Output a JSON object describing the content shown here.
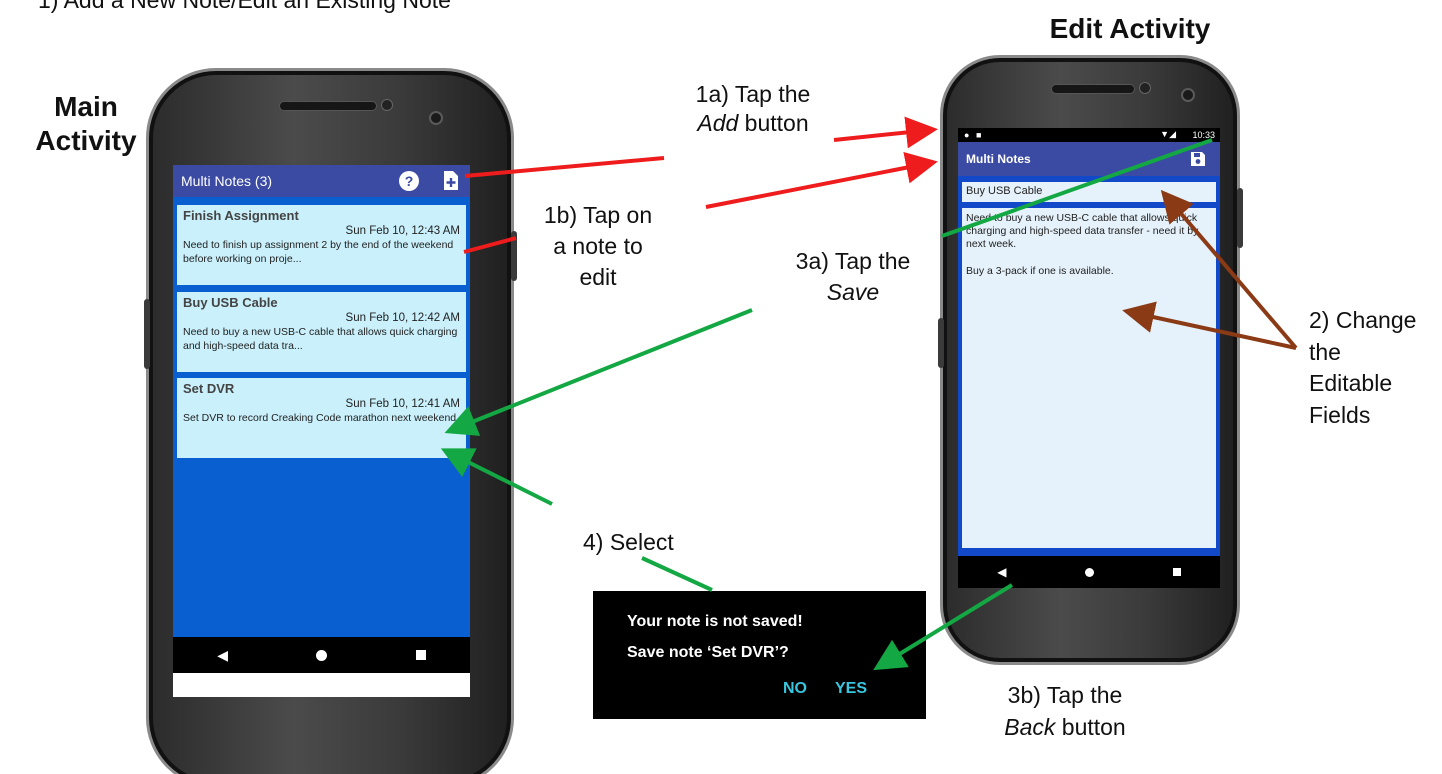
{
  "header_text": "1)  Add a New Note/Edit an Existing Note",
  "labels": {
    "main_activity": "Main Activity",
    "edit_activity": "Edit Activity"
  },
  "callouts": {
    "c1a_line1": "1a) Tap the",
    "c1a_em": "Add",
    "c1a_rest": " button",
    "c1b_line1": "1b) Tap on",
    "c1b_line2": "a note to",
    "c1b_line3": "edit",
    "c3a_line1": "3a) Tap the",
    "c3a_em": "Save",
    "c2_line1": "2) Change",
    "c2_line2": "the",
    "c2_line3": "Editable",
    "c2_line4": "Fields",
    "c3b_line1": "3b) Tap the",
    "c3b_em": "Back",
    "c3b_rest": " button",
    "c4": "4) Select"
  },
  "main_screen": {
    "app_title": "Multi Notes (3)",
    "help_icon": "help-icon",
    "add_icon": "add-note-icon",
    "notes": [
      {
        "title": "Finish Assignment",
        "date": "Sun Feb 10, 12:43 AM",
        "text": "Need to finish up assignment 2 by the end of the weekend before working on proje..."
      },
      {
        "title": "Buy USB Cable",
        "date": "Sun Feb 10, 12:42 AM",
        "text": "Need to buy a new USB-C cable that allows quick charging and high-speed data tra..."
      },
      {
        "title": "Set DVR",
        "date": "Sun Feb 10, 12:41 AM",
        "text": "Set DVR to record Creaking Code marathon next weekend."
      }
    ]
  },
  "edit_screen": {
    "app_title": "Multi Notes",
    "status_time": "10:33",
    "save_icon": "save-icon",
    "title_value": "Buy USB Cable",
    "body_line1": "Need to buy a new USB-C cable that allows quick charging and high-speed data transfer - need it by next week.",
    "body_line2": "Buy a 3-pack if one is available."
  },
  "dialog": {
    "line1": "Your note is not saved!",
    "line2": "Save note ‘Set DVR’?",
    "no_label": "NO",
    "yes_label": "YES"
  },
  "colors": {
    "red_arrow": "#ee1c1c",
    "green_arrow": "#13a843",
    "brown_arrow": "#8b3a16",
    "appbar": "#3b4aa3",
    "screen_bg": "#0a5fd0",
    "note_bg": "#c9f0fb",
    "dialog_button": "#38c6e0"
  }
}
